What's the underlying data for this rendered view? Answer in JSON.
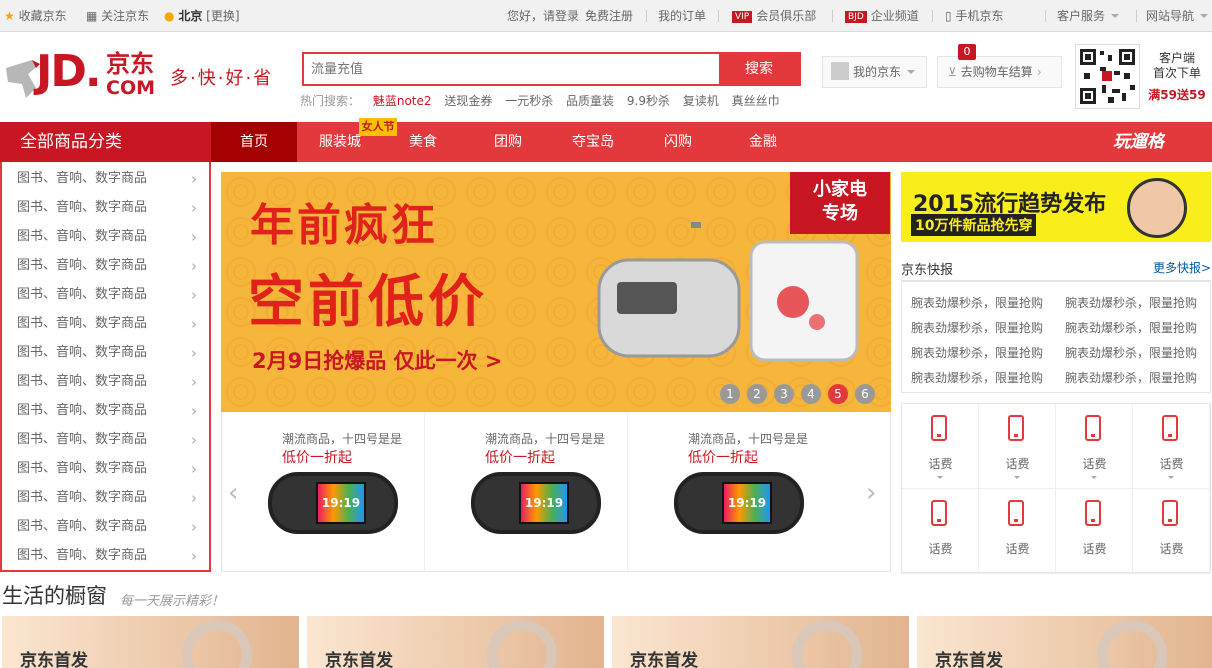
{
  "topbar": {
    "favorite": "收藏京东",
    "follow": "关注京东",
    "location": "北京",
    "change": "[更换]",
    "greeting": "您好，请登录",
    "register": "免费注册",
    "orders": "我的订单",
    "vip_badge": "VIP",
    "vip": "会员俱乐部",
    "bjd_badge": "BJD",
    "enterprise": "企业频道",
    "mobile": "手机京东",
    "service": "客户服务",
    "sitemap": "网站导航"
  },
  "header": {
    "logo_jd": "JD.",
    "logo_cn": "京东",
    "logo_com": "COM",
    "slogan": "多·快·好·省",
    "search_placeholder": "流量充值",
    "search_button": "搜索",
    "hot_label": "热门搜索：",
    "hot_words": [
      "魅蓝note2",
      "送现金券",
      "一元秒杀",
      "品质童装",
      "9.9秒杀",
      "复读机",
      "真丝丝巾"
    ],
    "my_jd": "我的京东",
    "cart": "去购物车结算",
    "cart_count": "0",
    "qr_text1": "客户端",
    "qr_text2": "首次下单",
    "qr_promo": "满59送59"
  },
  "nav": {
    "category_title": "全部商品分类",
    "items": [
      "首页",
      "服装城",
      "美食",
      "团购",
      "夺宝岛",
      "闪购",
      "金融"
    ],
    "tag": "女人节",
    "special": "玩遛格"
  },
  "categories": [
    "图书、音响、数字商品",
    "图书、音响、数字商品",
    "图书、音响、数字商品",
    "图书、音响、数字商品",
    "图书、音响、数字商品",
    "图书、音响、数字商品",
    "图书、音响、数字商品",
    "图书、音响、数字商品",
    "图书、音响、数字商品",
    "图书、音响、数字商品",
    "图书、音响、数字商品",
    "图书、音响、数字商品",
    "图书、音响、数字商品",
    "图书、音响、数字商品"
  ],
  "banner": {
    "title1": "年前疯狂",
    "title2": "空前低价",
    "subtitle": "2月9日抢爆品 仅此一次 >",
    "corner": "小家电专场",
    "pages": [
      "1",
      "2",
      "3",
      "4",
      "5",
      "6"
    ],
    "active_page": "5"
  },
  "products": [
    {
      "line1": "潮流商品，十四号是是",
      "line2": "低价一折起",
      "screen": "19:19"
    },
    {
      "line1": "潮流商品，十四号是是",
      "line2": "低价一折起",
      "screen": "19:19"
    },
    {
      "line1": "潮流商品，十四号是是",
      "line2": "低价一折起",
      "screen": "19:19"
    }
  ],
  "promo": {
    "line1": "2015流行趋势发布",
    "line2": "10万件新品抢先穿"
  },
  "news": {
    "title": "京东快报",
    "more": "更多快报>",
    "items": [
      "腕表劲爆秒杀，限量抢购",
      "腕表劲爆秒杀，限量抢购",
      "腕表劲爆秒杀，限量抢购",
      "腕表劲爆秒杀，限量抢购",
      "腕表劲爆秒杀，限量抢购",
      "腕表劲爆秒杀，限量抢购",
      "腕表劲爆秒杀，限量抢购",
      "腕表劲爆秒杀，限量抢购"
    ]
  },
  "services": [
    "话费",
    "话费",
    "话费",
    "话费",
    "话费",
    "话费",
    "话费",
    "话费"
  ],
  "life": {
    "title": "生活的橱窗",
    "subtitle": "每一天展示精彩！",
    "tiles": [
      "京东首发",
      "京东首发",
      "京东首发",
      "京东首发"
    ]
  }
}
